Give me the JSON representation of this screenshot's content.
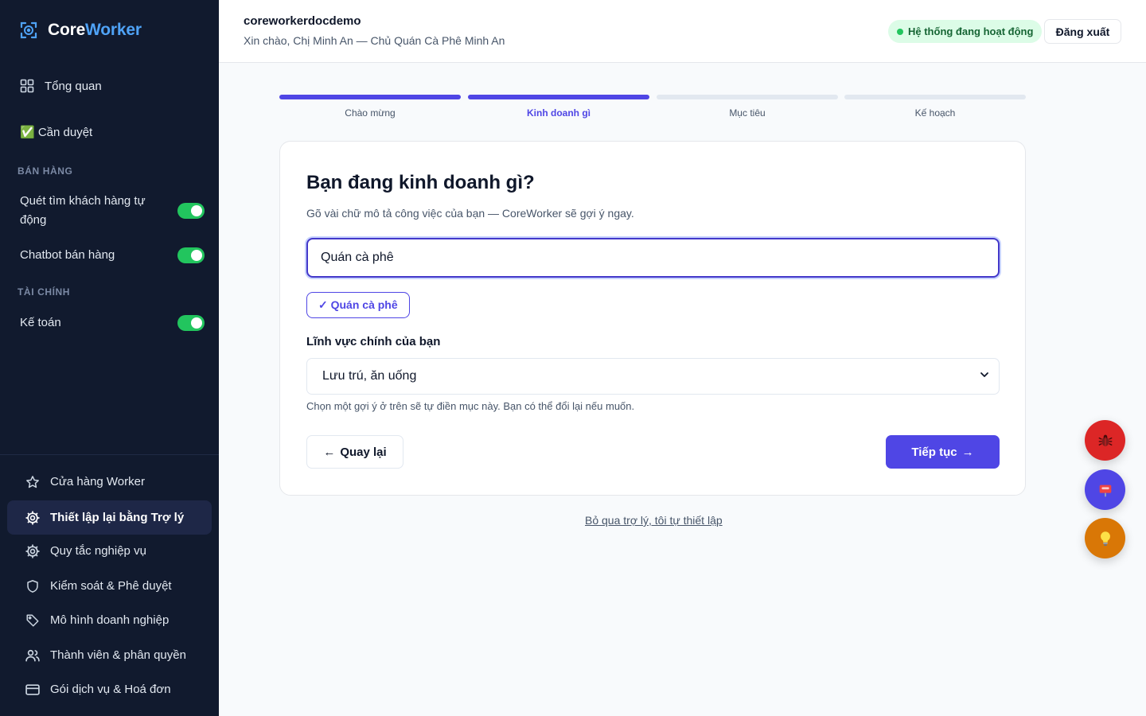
{
  "app": {
    "brand_part1": "Core",
    "brand_part2": "Worker"
  },
  "sidebar": {
    "overview": "Tổng quan",
    "pending": "✅ Cần duyệt",
    "sections": [
      {
        "label": "BÁN HÀNG",
        "items": [
          {
            "label": "Quét tìm khách hàng tự động",
            "enabled": true
          },
          {
            "label": "Chatbot bán hàng",
            "enabled": true
          }
        ]
      },
      {
        "label": "TÀI CHÍNH",
        "items": [
          {
            "label": "Kế toán",
            "enabled": true
          }
        ]
      }
    ],
    "bottom": [
      {
        "label": "Cửa hàng Worker",
        "icon": "star-icon"
      },
      {
        "label": "Thiết lập lại bằng Trợ lý",
        "icon": "gear-icon",
        "active": true
      },
      {
        "label": "Quy tắc nghiệp vụ",
        "icon": "gear-icon"
      },
      {
        "label": "Kiểm soát & Phê duyệt",
        "icon": "shield-icon"
      },
      {
        "label": "Mô hình doanh nghiệp",
        "icon": "tag-icon"
      },
      {
        "label": "Thành viên & phân quyền",
        "icon": "users-icon"
      },
      {
        "label": "Gói dịch vụ & Hoá đơn",
        "icon": "credit-card-icon"
      }
    ]
  },
  "header": {
    "workspace": "coreworkerdocdemo",
    "greeting": "Xin chào, Chị Minh An — Chủ Quán Cà Phê Minh An",
    "status": "Hệ thống đang hoạt động",
    "logout": "Đăng xuất"
  },
  "stepper": {
    "steps": [
      {
        "label": "Chào mừng",
        "state": "done"
      },
      {
        "label": "Kinh doanh gì",
        "state": "current"
      },
      {
        "label": "Mục tiêu",
        "state": "todo"
      },
      {
        "label": "Kế hoạch",
        "state": "todo"
      }
    ]
  },
  "form": {
    "title": "Bạn đang kinh doanh gì?",
    "subtitle": "Gõ vài chữ mô tả công việc của bạn — CoreWorker sẽ gợi ý ngay.",
    "business_value": "Quán cà phê",
    "suggestion_chip": "✓ Quán cà phê",
    "field_label": "Lĩnh vực chính của bạn",
    "field_value": "Lưu trú, ăn uống",
    "help": "Chọn một gợi ý ở trên sẽ tự điền mục này. Bạn có thể đổi lại nếu muốn.",
    "back_label": "Quay lại",
    "next_label": "Tiếp tục",
    "skip_label": "Bỏ qua trợ lý, tôi tự thiết lập"
  },
  "fabs": [
    {
      "icon": "bug-icon",
      "color": "#dc2626"
    },
    {
      "icon": "mailbox-icon",
      "color": "#4f46e5"
    },
    {
      "icon": "lightbulb-icon",
      "color": "#d97706"
    }
  ],
  "colors": {
    "sidebar_bg": "#111a2e",
    "accent": "#4f46e5",
    "brand_blue": "#4fa3f7",
    "toggle_on": "#22c55e"
  }
}
